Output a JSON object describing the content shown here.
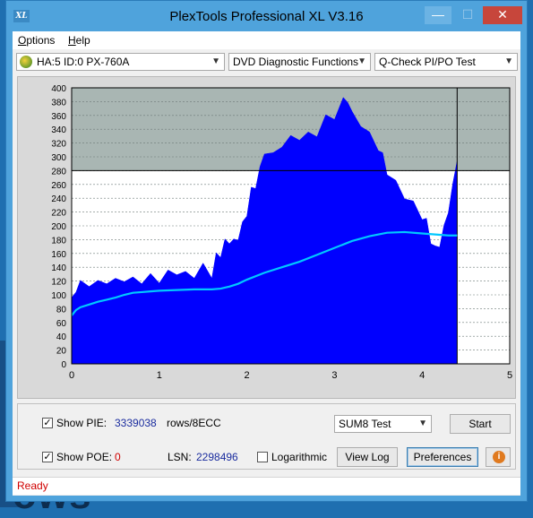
{
  "window": {
    "title": "PlexTools Professional XL V3.16",
    "icon_text": "XL",
    "controls": {
      "minimize": "—",
      "maximize": "☐",
      "close": "✕"
    }
  },
  "menu": [
    {
      "label": "Options",
      "underline": "O",
      "rest": "ptions"
    },
    {
      "label": "Help",
      "underline": "H",
      "rest": "elp"
    }
  ],
  "selectors": {
    "drive": "HA:5 ID:0  PX-760A",
    "function": "DVD Diagnostic Functions",
    "test": "Q-Check PI/PO Test"
  },
  "chart_data": {
    "type": "area",
    "x_ticks": [
      "0",
      "1",
      "2",
      "3",
      "4",
      "5"
    ],
    "y_ticks": [
      "0",
      "20",
      "40",
      "60",
      "80",
      "100",
      "120",
      "140",
      "160",
      "180",
      "200",
      "220",
      "240",
      "260",
      "280",
      "300",
      "320",
      "340",
      "360",
      "380",
      "400"
    ],
    "xlim": [
      0,
      5
    ],
    "ylim": [
      0,
      400
    ],
    "threshold": 280,
    "end_x": 4.4,
    "grid": true,
    "series": [
      {
        "kind": "pie",
        "color": "#0000ff",
        "x": [
          0,
          0.05,
          0.1,
          0.2,
          0.3,
          0.4,
          0.5,
          0.6,
          0.7,
          0.8,
          0.9,
          1.0,
          1.1,
          1.2,
          1.3,
          1.4,
          1.5,
          1.6,
          1.65,
          1.7,
          1.75,
          1.8,
          1.85,
          1.9,
          1.95,
          2.0,
          2.05,
          2.1,
          2.15,
          2.2,
          2.3,
          2.4,
          2.5,
          2.6,
          2.7,
          2.8,
          2.9,
          3.0,
          3.1,
          3.15,
          3.2,
          3.3,
          3.4,
          3.5,
          3.55,
          3.6,
          3.7,
          3.8,
          3.9,
          4.0,
          4.05,
          4.1,
          4.15,
          4.2,
          4.25,
          4.3,
          4.35,
          4.4
        ],
        "y": [
          90,
          110,
          115,
          118,
          115,
          122,
          118,
          125,
          120,
          122,
          125,
          123,
          130,
          135,
          128,
          130,
          140,
          130,
          155,
          160,
          175,
          180,
          175,
          185,
          200,
          220,
          250,
          260,
          280,
          310,
          300,
          320,
          325,
          330,
          330,
          335,
          355,
          360,
          380,
          385,
          360,
          350,
          330,
          315,
          300,
          280,
          260,
          245,
          230,
          215,
          205,
          180,
          165,
          175,
          195,
          225,
          255,
          300
        ]
      },
      {
        "kind": "sum8",
        "color": "#00c8ff",
        "x": [
          0,
          0.05,
          0.1,
          0.2,
          0.3,
          0.4,
          0.5,
          0.6,
          0.7,
          0.8,
          0.9,
          1.0,
          1.2,
          1.4,
          1.6,
          1.7,
          1.8,
          1.9,
          2.0,
          2.2,
          2.4,
          2.6,
          2.8,
          3.0,
          3.2,
          3.4,
          3.6,
          3.8,
          4.0,
          4.1,
          4.2,
          4.3,
          4.4
        ],
        "y": [
          70,
          78,
          82,
          86,
          90,
          93,
          96,
          100,
          103,
          104,
          105,
          106,
          107,
          108,
          108,
          109,
          112,
          116,
          122,
          132,
          140,
          148,
          158,
          168,
          178,
          185,
          190,
          191,
          189,
          188,
          187,
          186,
          186
        ]
      }
    ]
  },
  "controls": {
    "show_pie_label": "Show PIE:",
    "show_pie_checked": "✓",
    "pie_value": "3339038",
    "pie_unit": "rows/8ECC",
    "show_poe_label": "Show POE:",
    "show_poe_checked": "✓",
    "poe_value": "0",
    "lsn_label": "LSN:",
    "lsn_value": "2298496",
    "logarithmic_label": "Logarithmic",
    "sum_select": "SUM8 Test",
    "start_label": "Start",
    "viewlog_label": "View Log",
    "preferences_label": "Preferences",
    "info_symbol": "i"
  },
  "status": {
    "text": "Ready"
  },
  "desktop": {
    "partial_text": "ows"
  }
}
